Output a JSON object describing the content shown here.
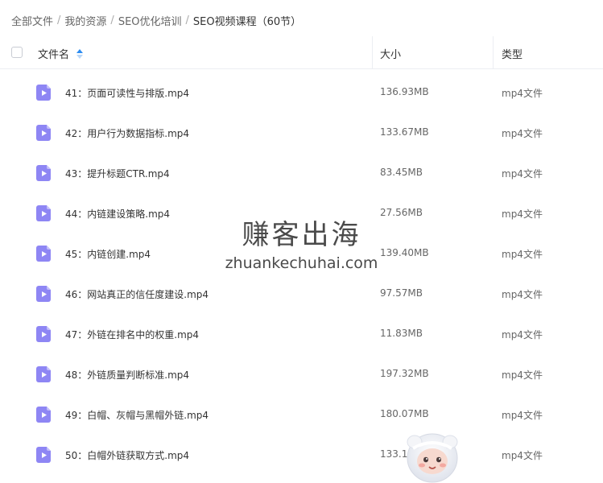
{
  "breadcrumb": {
    "items": [
      "全部文件",
      "我的资源",
      "SEO优化培训",
      "SEO视频课程（60节）"
    ],
    "separator": "/"
  },
  "table": {
    "columns": {
      "name": "文件名",
      "size": "大小",
      "type": "类型"
    },
    "sort": {
      "column": "name",
      "direction": "asc"
    },
    "rows": [
      {
        "name": "41：页面可读性与排版.mp4",
        "size": "136.93MB",
        "type": "mp4文件"
      },
      {
        "name": "42：用户行为数据指标.mp4",
        "size": "133.67MB",
        "type": "mp4文件"
      },
      {
        "name": "43：提升标题CTR.mp4",
        "size": "83.45MB",
        "type": "mp4文件"
      },
      {
        "name": "44：内链建设策略.mp4",
        "size": "27.56MB",
        "type": "mp4文件"
      },
      {
        "name": "45：内链创建.mp4",
        "size": "139.40MB",
        "type": "mp4文件"
      },
      {
        "name": "46：网站真正的信任度建设.mp4",
        "size": "97.57MB",
        "type": "mp4文件"
      },
      {
        "name": "47：外链在排名中的权重.mp4",
        "size": "11.83MB",
        "type": "mp4文件"
      },
      {
        "name": "48：外链质量判断标准.mp4",
        "size": "197.32MB",
        "type": "mp4文件"
      },
      {
        "name": "49：白帽、灰帽与黑帽外链.mp4",
        "size": "180.07MB",
        "type": "mp4文件"
      },
      {
        "name": "50：白帽外链获取方式.mp4",
        "size": "133.1",
        "type": "mp4文件"
      }
    ]
  },
  "watermark": {
    "title": "赚客出海",
    "url": "zhuankechuhai.com"
  },
  "icons": {
    "file": "video-file-icon",
    "sort": "sort-arrows-icon",
    "mascot": "mascot-character"
  },
  "colors": {
    "file_icon": "#8e86f4",
    "sort_active": "#2d8cf0",
    "divider": "#eceef2"
  }
}
